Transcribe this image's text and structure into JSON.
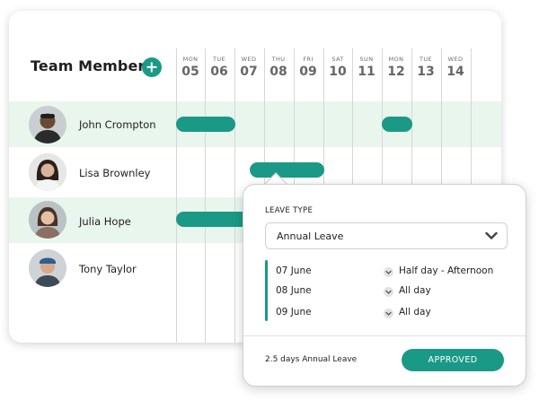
{
  "header": {
    "title": "Team Members"
  },
  "days": [
    {
      "dow": "MON",
      "num": "05"
    },
    {
      "dow": "TUE",
      "num": "06"
    },
    {
      "dow": "WED",
      "num": "07"
    },
    {
      "dow": "THU",
      "num": "08"
    },
    {
      "dow": "FRI",
      "num": "09"
    },
    {
      "dow": "SAT",
      "num": "10"
    },
    {
      "dow": "SUN",
      "num": "11"
    },
    {
      "dow": "MON",
      "num": "12"
    },
    {
      "dow": "TUE",
      "num": "13"
    },
    {
      "dow": "WED",
      "num": "14"
    }
  ],
  "members": [
    {
      "name": "John Crompton"
    },
    {
      "name": "Lisa Brownley"
    },
    {
      "name": "Julia Hope"
    },
    {
      "name": "Tony Taylor"
    }
  ],
  "popup": {
    "leave_type_label": "LEAVE TYPE",
    "leave_type_value": "Annual Leave",
    "entries": [
      {
        "date": "07 June",
        "duration": "Half day - Afternoon"
      },
      {
        "date": "08 June",
        "duration": "All day"
      },
      {
        "date": "09 June",
        "duration": "All day"
      }
    ],
    "summary": "2.5 days Annual Leave",
    "status_label": "APPROVED"
  },
  "colors": {
    "accent": "#1a9a86",
    "highlight_row": "#e9f6ee"
  }
}
